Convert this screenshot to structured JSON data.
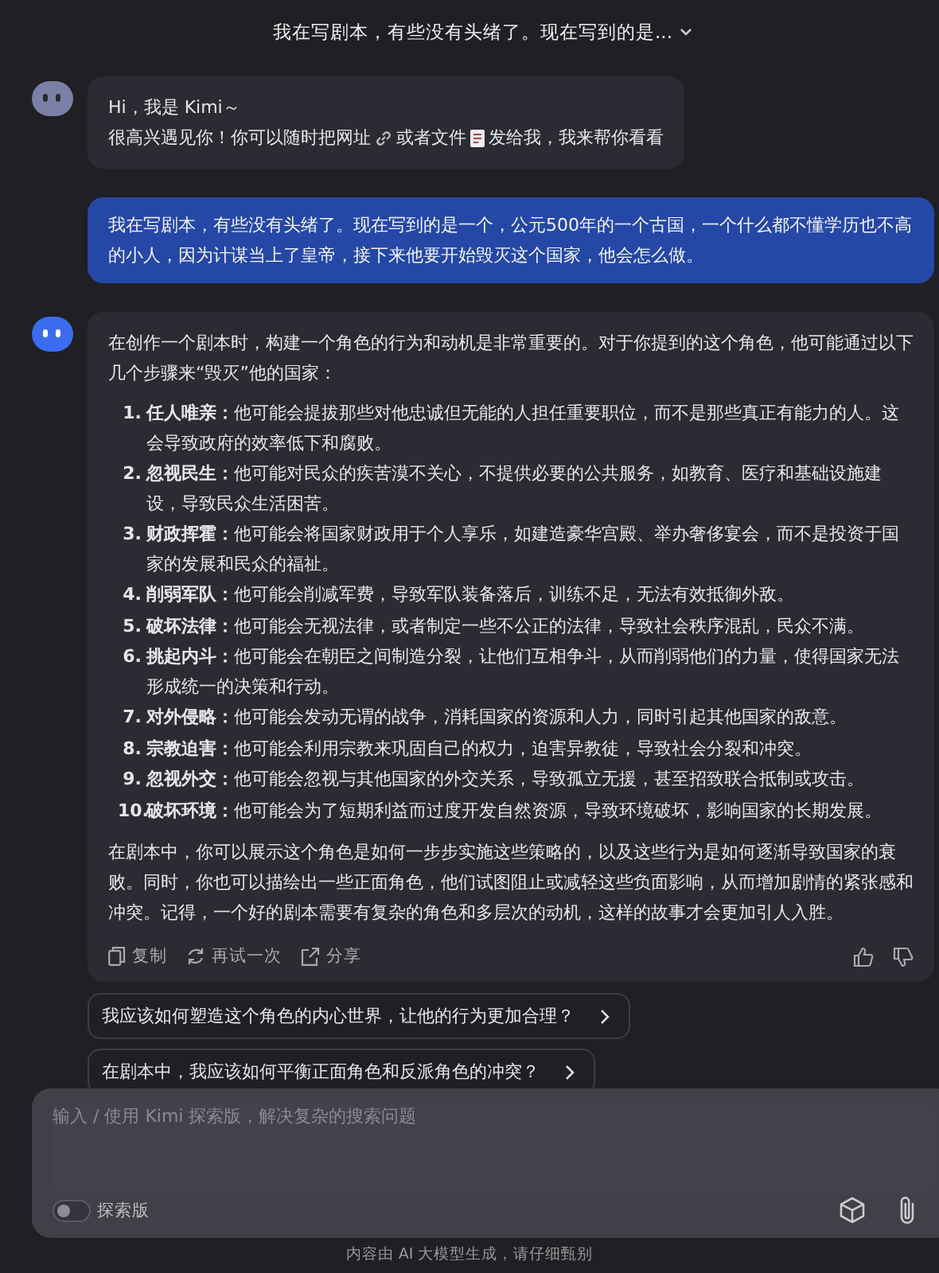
{
  "header": {
    "title": "我在写剧本，有些没有头绪了。现在写到的是..."
  },
  "greeting": {
    "line_1": "Hi，我是 Kimi～",
    "line_2_parts": [
      "很高兴遇见你！你可以随时把网址",
      "或者文件",
      "发给我，我来帮你看看"
    ]
  },
  "user_message": "我在写剧本，有些没有头绪了。现在写到的是一个，公元500年的一个古国，一个什么都不懂学历也不高的小人，因为计谋当上了皇帝，接下来他要开始毁灭这个国家，他会怎么做。",
  "answer": {
    "intro": "在创作一个剧本时，构建一个角色的行为和动机是非常重要的。对于你提到的这个角色，他可能通过以下几个步骤来“毁灭”他的国家：",
    "steps": [
      {
        "number": "1.",
        "title": "任人唯亲：",
        "text": "他可能会提拔那些对他忠诚但无能的人担任重要职位，而不是那些真正有能力的人。这会导致政府的效率低下和腐败。"
      },
      {
        "number": "2.",
        "title": "忽视民生：",
        "text": "他可能对民众的疾苦漠不关心，不提供必要的公共服务，如教育、医疗和基础设施建设，导致民众生活困苦。"
      },
      {
        "number": "3.",
        "title": "财政挥霍：",
        "text": "他可能会将国家财政用于个人享乐，如建造豪华宫殿、举办奢侈宴会，而不是投资于国家的发展和民众的福祉。"
      },
      {
        "number": "4.",
        "title": "削弱军队：",
        "text": "他可能会削减军费，导致军队装备落后，训练不足，无法有效抵御外敌。"
      },
      {
        "number": "5.",
        "title": "破坏法律：",
        "text": "他可能会无视法律，或者制定一些不公正的法律，导致社会秩序混乱，民众不满。"
      },
      {
        "number": "6.",
        "title": "挑起内斗：",
        "text": "他可能会在朝臣之间制造分裂，让他们互相争斗，从而削弱他们的力量，使得国家无法形成统一的决策和行动。"
      },
      {
        "number": "7.",
        "title": "对外侵略：",
        "text": "他可能会发动无谓的战争，消耗国家的资源和人力，同时引起其他国家的敌意。"
      },
      {
        "number": "8.",
        "title": "宗教迫害：",
        "text": "他可能会利用宗教来巩固自己的权力，迫害异教徒，导致社会分裂和冲突。"
      },
      {
        "number": "9.",
        "title": "忽视外交：",
        "text": "他可能会忽视与其他国家的外交关系，导致孤立无援，甚至招致联合抵制或攻击。"
      },
      {
        "number": "10.",
        "title": "破坏环境：",
        "text": "他可能会为了短期利益而过度开发自然资源，导致环境破坏，影响国家的长期发展。"
      }
    ],
    "conclusion": "在剧本中，你可以展示这个角色是如何一步步实施这些策略的，以及这些行为是如何逐渐导致国家的衰败。同时，你也可以描绘出一些正面角色，他们试图阻止或减轻这些负面影响，从而增加剧情的紧张感和冲突。记得，一个好的剧本需要有复杂的角色和多层次的动机，这样的故事才会更加引人入胜。",
    "actions": [
      "复制",
      "再试一次",
      "分享"
    ]
  },
  "suggestions": [
    "我应该如何塑造这个角色的内心世界，让他的行为更加合理？",
    "在剧本中，我应该如何平衡正面角色和反派角色的冲突？"
  ],
  "composer": {
    "placeholder": "输入 / 使用 Kimi 探索版，解决复杂的搜索问题",
    "explore_mode": {
      "label": "探索版",
      "on": false
    }
  },
  "footer": "内容由 AI 大模型生成，请仔细甄别"
}
